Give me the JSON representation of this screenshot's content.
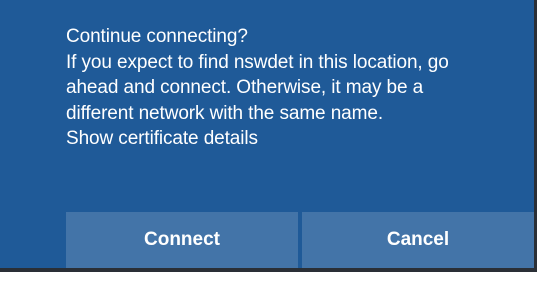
{
  "dialog": {
    "title": "Continue connecting?",
    "message_lines": [
      "If you expect to find nswdet in this location, go",
      "ahead and connect. Otherwise, it may be a",
      "different network with the same name."
    ],
    "certificate_link": "Show certificate details"
  },
  "buttons": {
    "connect_label": "Connect",
    "cancel_label": "Cancel"
  },
  "colors": {
    "panel_background": "#1f5a98",
    "button_background": "#4374a8",
    "text": "#ffffff"
  }
}
